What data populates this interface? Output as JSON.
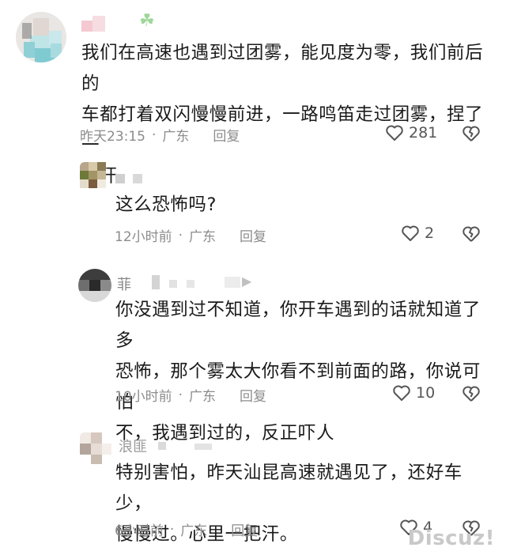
{
  "comments": [
    {
      "text_lines": [
        "我们在高速也遇到过团雾，能见度为零，我们前后的",
        "车都打着双闪慢慢前进，一路鸣笛走过团雾，捏了一",
        "把汗"
      ],
      "time": "昨天23:15",
      "location": "广东",
      "reply_label": "回复",
      "likes": "281"
    },
    {
      "text_lines": [
        "这么恐怖吗?"
      ],
      "time": "12小时前",
      "location": "广东",
      "reply_label": "回复",
      "likes": "2"
    },
    {
      "name_partial": "菲",
      "text_lines": [
        "你没遇到过不知道，你开车遇到的话就知道了多",
        "恐怖，那个雾太大你看不到前面的路，你说可怕",
        "不，我遇到过的，反正吓人"
      ],
      "time": "10小时前",
      "location": "广东",
      "reply_label": "回复",
      "likes": "10"
    },
    {
      "name_partial": "浪匪",
      "text_lines": [
        "特别害怕，昨天汕昆高速就遇见了，还好车少，",
        "慢慢过。心里一把汗。"
      ],
      "time": "6小时前",
      "location": "广东",
      "reply_label": "回复",
      "likes": "4"
    }
  ],
  "meta_separator": "·",
  "watermark": "Discuz!",
  "icons": {
    "like": "heart-outline-icon",
    "dislike": "broken-heart-icon"
  },
  "colors": {
    "text": "#1a1a1a",
    "meta": "#8c8c8c",
    "watermark": "#c9c9c9"
  }
}
